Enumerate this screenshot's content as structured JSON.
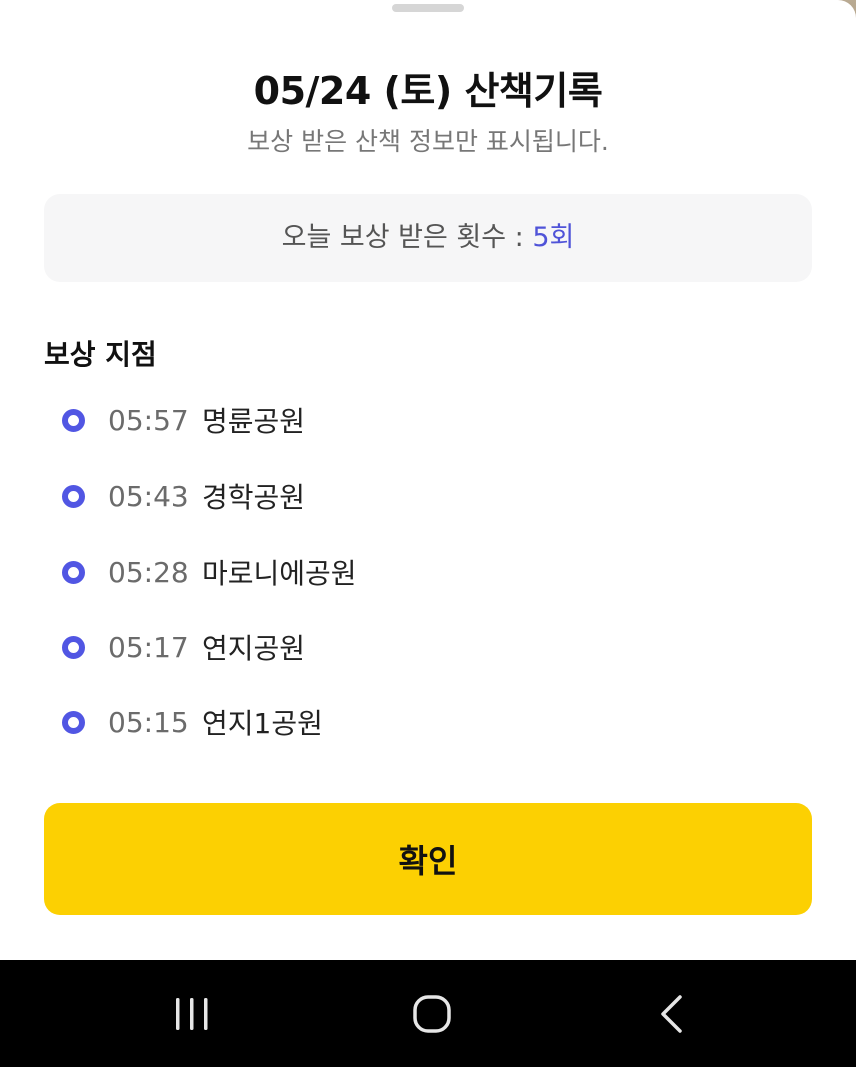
{
  "sheet": {
    "title": "05/24 (토) 산책기록",
    "subtitle": "보상 받은 산책 정보만 표시됩니다.",
    "reward_count": {
      "label": "오늘 보상 받은 횟수 : ",
      "value": "5회"
    },
    "section_title": "보상 지점",
    "rewards": [
      {
        "time": "05:57",
        "place": "명륜공원"
      },
      {
        "time": "05:43",
        "place": "경학공원"
      },
      {
        "time": "05:28",
        "place": "마로니에공원"
      },
      {
        "time": "05:17",
        "place": "연지공원"
      },
      {
        "time": "05:15",
        "place": "연지1공원"
      }
    ],
    "confirm_label": "확인"
  },
  "nav_bar": {
    "icons": [
      "recent-apps-icon",
      "home-icon",
      "back-icon"
    ]
  },
  "colors": {
    "accent": "#5156e3",
    "button": "#fcd002",
    "count_value": "#4f53d8",
    "nav_background": "#000000"
  }
}
